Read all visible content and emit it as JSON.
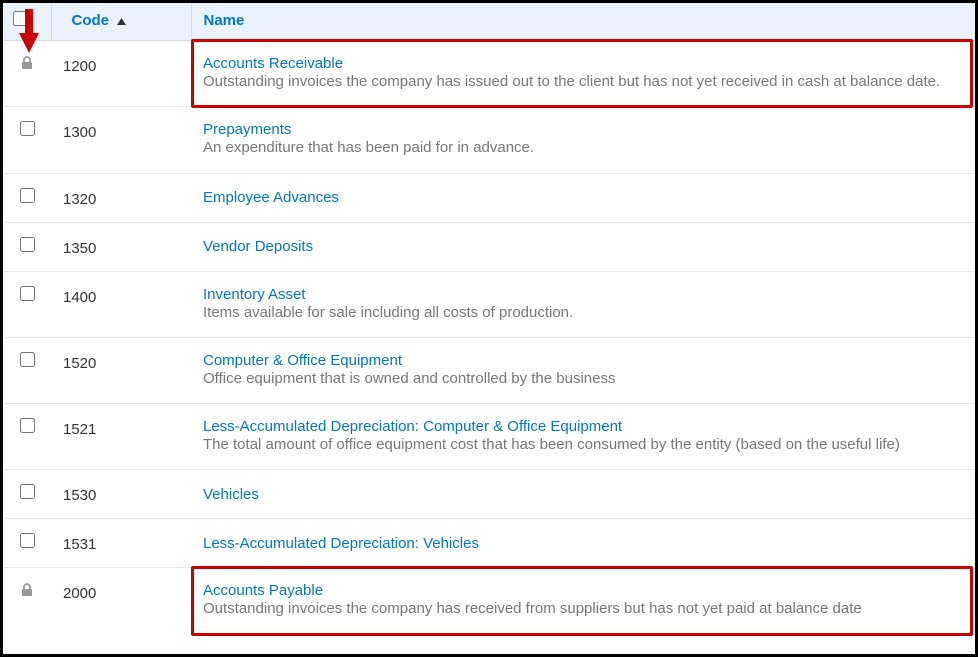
{
  "headers": {
    "code": "Code",
    "name": "Name"
  },
  "rows": [
    {
      "locked": true,
      "code": "1200",
      "name": "Accounts Receivable",
      "desc": "Outstanding invoices the company has issued out to the client but has not yet received in cash at balance date.",
      "highlight": true
    },
    {
      "locked": false,
      "code": "1300",
      "name": "Prepayments",
      "desc": "An expenditure that has been paid for in advance."
    },
    {
      "locked": false,
      "code": "1320",
      "name": "Employee Advances",
      "desc": ""
    },
    {
      "locked": false,
      "code": "1350",
      "name": "Vendor Deposits",
      "desc": ""
    },
    {
      "locked": false,
      "code": "1400",
      "name": "Inventory Asset",
      "desc": "Items available for sale including all costs of production."
    },
    {
      "locked": false,
      "code": "1520",
      "name": "Computer & Office Equipment",
      "desc": "Office equipment that is owned and controlled by the business"
    },
    {
      "locked": false,
      "code": "1521",
      "name": "Less-Accumulated Depreciation: Computer & Office Equipment",
      "desc": "The total amount of office equipment cost that has been consumed by the entity (based on the useful life)"
    },
    {
      "locked": false,
      "code": "1530",
      "name": "Vehicles",
      "desc": ""
    },
    {
      "locked": false,
      "code": "1531",
      "name": "Less-Accumulated Depreciation: Vehicles",
      "desc": ""
    },
    {
      "locked": true,
      "code": "2000",
      "name": "Accounts Payable",
      "desc": "Outstanding invoices the company has received from suppliers but has not yet paid at balance date",
      "highlight": true
    }
  ],
  "annotations": {
    "arrow_color": "#cc0000"
  }
}
